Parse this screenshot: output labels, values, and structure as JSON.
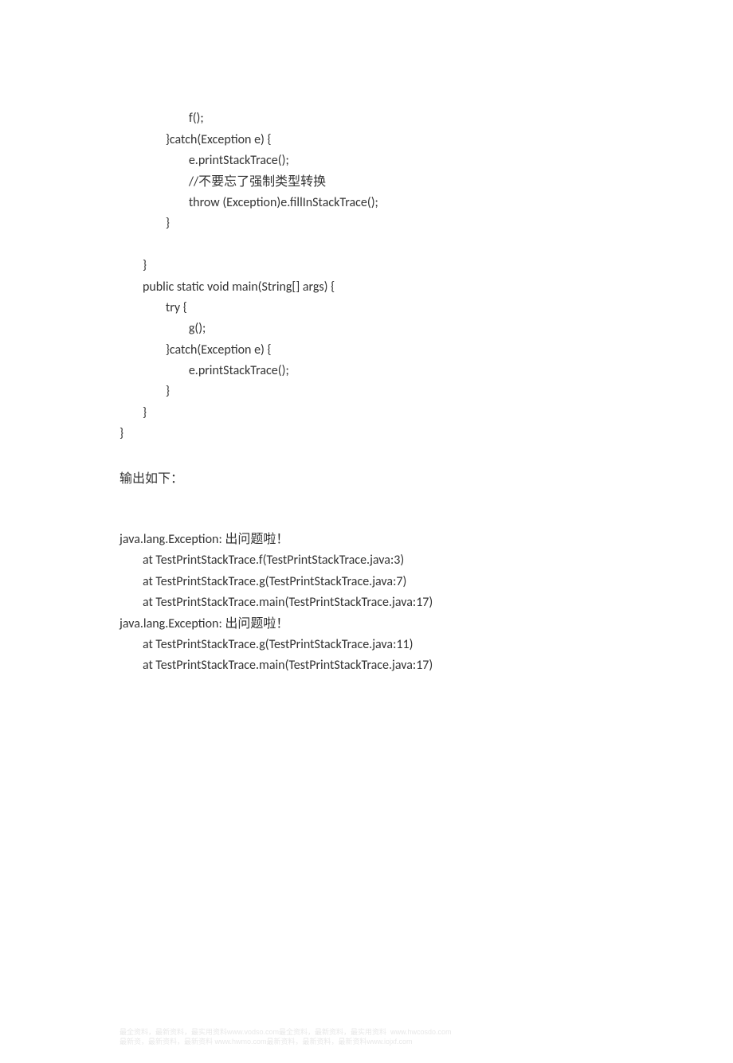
{
  "code": {
    "line1": "                        f();",
    "line2": "                }catch(Exception e) {",
    "line3": "                        e.printStackTrace();",
    "line4_prefix": "                        //",
    "line4_cjk": "不要忘了强制类型转换",
    "line5": "                        throw (Exception)e.fillInStackTrace();",
    "line6": "                }",
    "line7": "",
    "line8": "        }",
    "line9": "        public static void main(String[] args) {",
    "line10": "                try {",
    "line11": "                        g();",
    "line12": "                }catch(Exception e) {",
    "line13": "                        e.printStackTrace();",
    "line14": "                }",
    "line15": "        }",
    "line16": "}"
  },
  "output_label": "输出如下：",
  "output": {
    "line1_prefix": "java.lang.Exception: ",
    "line1_cjk": "出问题啦！",
    "line2": "        at TestPrintStackTrace.f(TestPrintStackTrace.java:3)",
    "line3": "        at TestPrintStackTrace.g(TestPrintStackTrace.java:7)",
    "line4": "        at TestPrintStackTrace.main(TestPrintStackTrace.java:17)",
    "line5_prefix": "java.lang.Exception: ",
    "line5_cjk": "出问题啦！",
    "line6": "        at TestPrintStackTrace.g(TestPrintStackTrace.java:11)",
    "line7": "        at TestPrintStackTrace.main(TestPrintStackTrace.java:17)"
  },
  "watermark": {
    "line1": "最全资料，最新资料，最实用资料www.vodso.com最全资料，最新资料，最实用资料  www.hwcosdo.com",
    "line2": "最新资，最新资料，最新资料 www.hwmo.com最新资料，最新资料，最新资料www.iojxf.com"
  }
}
